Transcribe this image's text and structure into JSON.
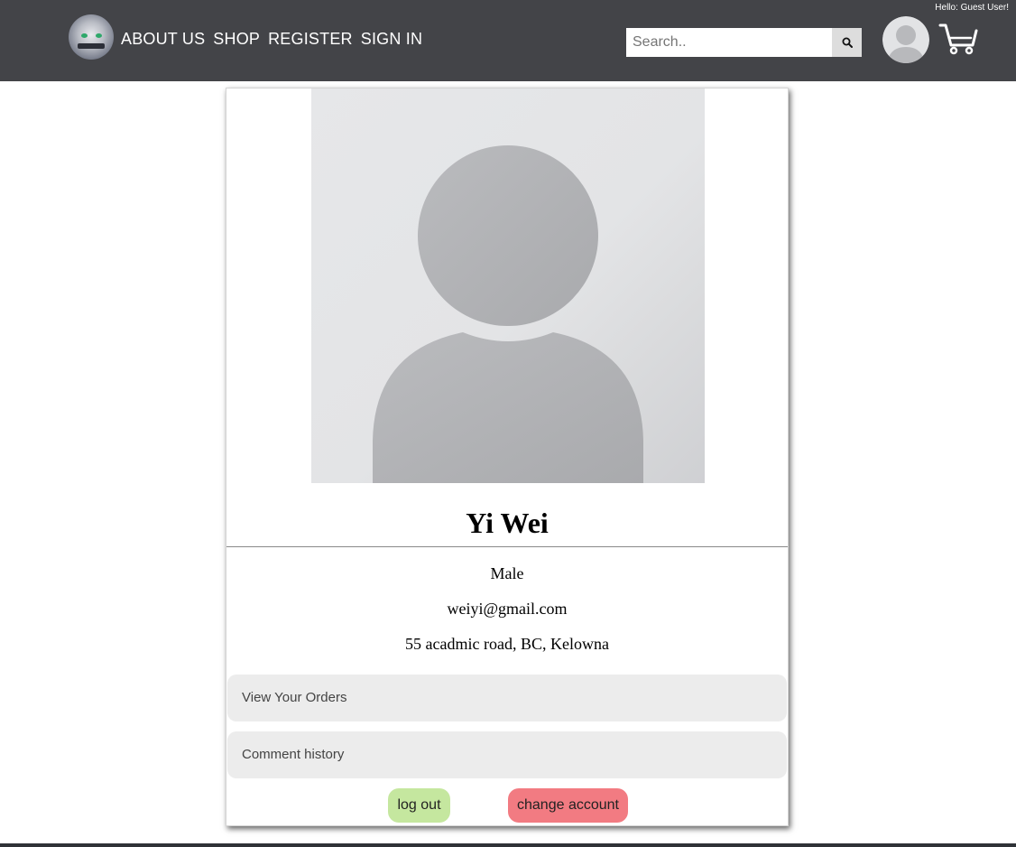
{
  "header": {
    "greeting": "Hello: Guest User!",
    "nav": {
      "about": "ABOUT US",
      "shop": "SHOP",
      "register": "REGISTER",
      "signin": "SIGN IN"
    },
    "search": {
      "placeholder": "Search..",
      "icon": "search-icon"
    },
    "icons": {
      "logo": "brand-logo",
      "avatar": "user-avatar-icon",
      "cart": "cart-icon"
    }
  },
  "profile": {
    "name": "Yi Wei",
    "gender": "Male",
    "email": "weiyi@gmail.com",
    "address": "55 acadmic road, BC, Kelowna",
    "panels": {
      "orders": "View Your Orders",
      "comments": "Comment history"
    },
    "buttons": {
      "logout": "log out",
      "change_account": "change account"
    }
  },
  "colors": {
    "header_bg": "#434448",
    "panel_bg": "#ececec",
    "logout_bg": "#c5e79f",
    "change_bg": "#f27b82"
  }
}
